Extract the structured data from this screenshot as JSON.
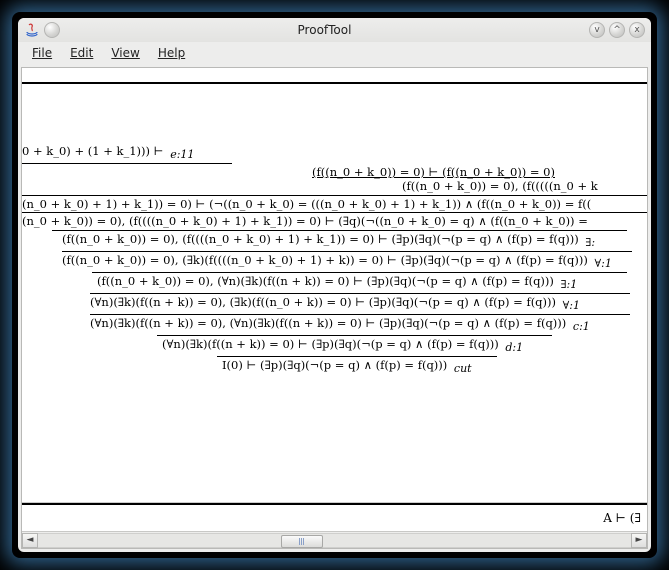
{
  "window": {
    "title": "ProofTool",
    "buttons": {
      "minimize": "v",
      "maximize": "^",
      "close": "x"
    }
  },
  "menubar": {
    "items": [
      {
        "label": "File"
      },
      {
        "label": "Edit"
      },
      {
        "label": "View"
      },
      {
        "label": "Help"
      }
    ]
  },
  "proof": {
    "l0": "0 + k_0) + (1 + k_1))) ⊢",
    "r0": "e:11",
    "l1": "(f((n_0 + k_0)) = 0) ⊢ (f((n_0 + k_0)) = 0)",
    "l2": "(f((n_0 + k_0)) = 0), (f(((((n_0 + k",
    "l3": "(n_0 + k_0) + 1) + k_1)) = 0) ⊢ (¬((n_0 + k_0) = (((n_0 + k_0) + 1) + k_1)) ∧ (f((n_0 + k_0)) = f((",
    "l4": "(n_0 + k_0)) = 0), (f((((n_0 + k_0) + 1) + k_1)) = 0) ⊢ (∃q)(¬((n_0 + k_0) = q) ∧ (f((n_0 + k_0)) =",
    "l5": "(f((n_0 + k_0)) = 0), (f((((n_0 + k_0) + 1) + k_1)) = 0) ⊢ (∃p)(∃q)(¬(p = q) ∧ (f(p) = f(q)))",
    "r5": "∃:",
    "l6": "(f((n_0 + k_0)) = 0), (∃k)(f((((n_0 + k_0) + 1) + k)) = 0) ⊢ (∃p)(∃q)(¬(p = q) ∧ (f(p) = f(q)))",
    "r6": "∀:1",
    "l7": "(f((n_0 + k_0)) = 0), (∀n)(∃k)(f((n + k)) = 0) ⊢ (∃p)(∃q)(¬(p = q) ∧ (f(p) = f(q)))",
    "r7": "∃:1",
    "l8": "(∀n)(∃k)(f((n + k)) = 0), (∃k)(f((n_0 + k)) = 0) ⊢ (∃p)(∃q)(¬(p = q) ∧ (f(p) = f(q)))",
    "r8": "∀:1",
    "l9": "(∀n)(∃k)(f((n + k)) = 0), (∀n)(∃k)(f((n + k)) = 0) ⊢ (∃p)(∃q)(¬(p = q) ∧ (f(p) = f(q)))",
    "r9": "c:1",
    "l10": "(∀n)(∃k)(f((n + k)) = 0) ⊢ (∃p)(∃q)(¬(p = q) ∧ (f(p) = f(q)))",
    "r10": "d:1",
    "l11": "I(0) ⊢ (∃p)(∃q)(¬(p = q) ∧ (f(p) = f(q)))",
    "r11": "cut"
  },
  "lower": {
    "right": "A ⊢ (∃"
  },
  "scrollbar": {
    "thumb_left_pct": 41,
    "thumb_width_pct": 7
  }
}
